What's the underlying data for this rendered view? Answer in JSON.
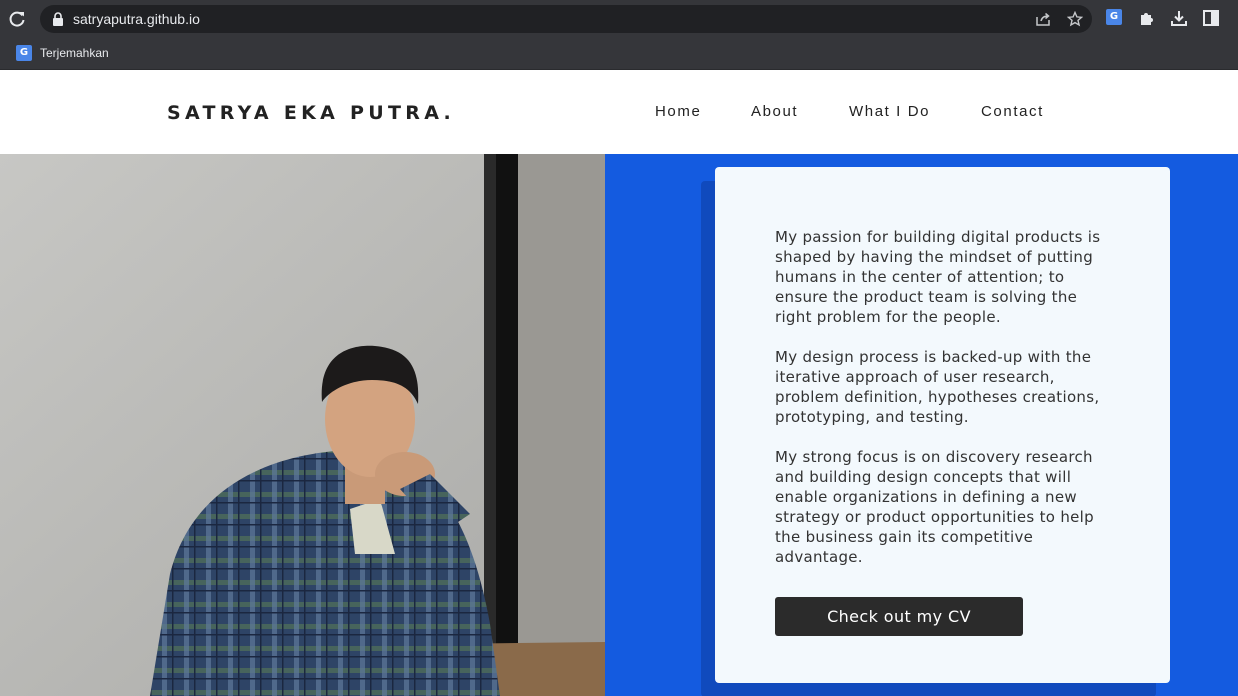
{
  "browser": {
    "url": "satryaputra.github.io",
    "bookmarks": [
      {
        "label": "Terjemahkan",
        "icon": "google-translate-icon"
      }
    ],
    "icons": [
      "reload-icon",
      "lock-icon",
      "share-icon",
      "star-icon",
      "google-translate-icon",
      "extensions-icon",
      "download-icon",
      "side-panel-icon"
    ]
  },
  "header": {
    "brand": "SATRYA EKA PUTRA.",
    "nav": [
      {
        "label": "Home"
      },
      {
        "label": "About"
      },
      {
        "label": "What I Do"
      },
      {
        "label": "Contact"
      }
    ]
  },
  "about": {
    "paragraphs": [
      "My passion for building digital products is shaped by having the mindset of putting humans in the center of attention; to ensure the product team is solving the right problem for the people.",
      "My design process is backed-up with the iterative approach of user research, problem definition, hypotheses creations, prototyping, and testing.",
      "My strong focus is on discovery research and building design concepts that will enable organizations in defining a new strategy or product opportunities to help the business gain its competitive advantage."
    ],
    "cv_button": "Check out my CV"
  },
  "colors": {
    "accent_blue": "#145be0",
    "card_bg": "#f3f9fd",
    "button_bg": "#2b2b2b",
    "chrome_bg": "#35363a"
  }
}
